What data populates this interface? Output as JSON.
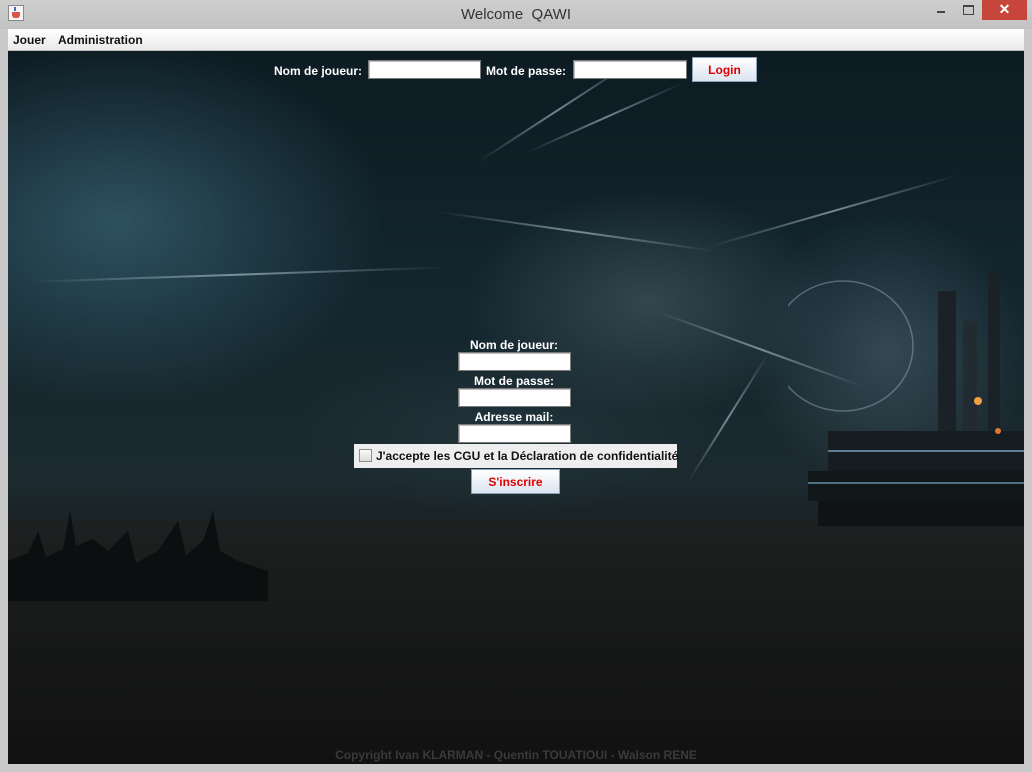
{
  "window": {
    "title": "Welcome  QAWI",
    "close_symbol": "✕",
    "icons": {
      "app": "java-cup-icon",
      "minimize": "minimize-icon",
      "maximize": "maximize-icon",
      "close": "close-icon"
    }
  },
  "menu": {
    "items": [
      {
        "label": "Jouer"
      },
      {
        "label": "Administration"
      }
    ]
  },
  "login": {
    "username_label": "Nom de joueur:",
    "username_value": "",
    "password_label": "Mot de passe:",
    "password_value": "",
    "button_label": "Login"
  },
  "register": {
    "username_label": "Nom de joueur:",
    "username_value": "",
    "password_label": "Mot de passe:",
    "password_value": "",
    "email_label": "Adresse mail:",
    "email_value": "",
    "cgu_label": "J'accepte les CGU et la Déclaration de confidentialité",
    "cgu_checked": false,
    "button_label": "S'inscrire"
  },
  "footer": {
    "copyright": "Copyright Ivan KLARMAN - Quentin TOUATIOUI - Walson RENE"
  },
  "colors": {
    "button_text": "#e00000",
    "close_button": "#c7463c",
    "background_dark": "#0f1a1f"
  }
}
